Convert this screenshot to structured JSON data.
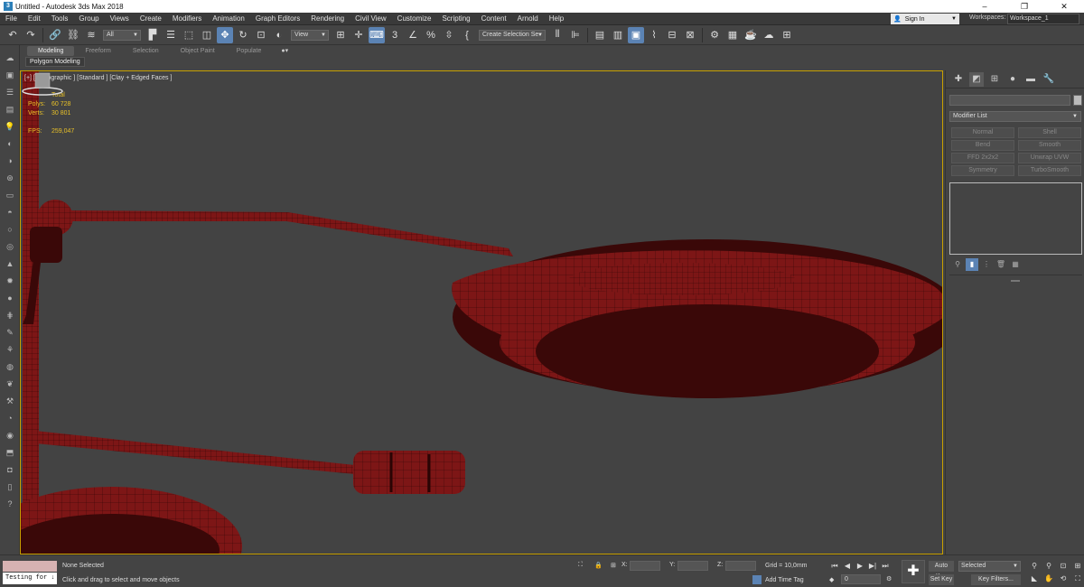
{
  "window": {
    "title": "Untitled - Autodesk 3ds Max 2018",
    "app_icon": "3",
    "controls": [
      "–",
      "❐",
      "✕"
    ]
  },
  "menu": {
    "items": [
      "File",
      "Edit",
      "Tools",
      "Group",
      "Views",
      "Create",
      "Modifiers",
      "Animation",
      "Graph Editors",
      "Rendering",
      "Civil View",
      "Customize",
      "Scripting",
      "Content",
      "Arnold",
      "Help"
    ],
    "sign_in": "Sign In",
    "workspaces_label": "Workspaces:",
    "workspace_value": "Workspace_1"
  },
  "toolbar": {
    "selection_filter": "All",
    "ref_coord": "View",
    "named_selection": "Create Selection Se"
  },
  "ribbon": {
    "tabs": [
      "Modeling",
      "Freeform",
      "Selection",
      "Object Paint",
      "Populate"
    ],
    "active_tab": "Modeling",
    "dots": "●▾",
    "polygon_modeling": "Polygon Modeling"
  },
  "viewport": {
    "label": "[+] [Orthographic ] [Standard ] [Clay + Edged Faces ]",
    "stats": {
      "total_label": "Total",
      "polys_label": "Polys:",
      "polys_value": "60 728",
      "verts_label": "Verts:",
      "verts_value": "30 801",
      "fps_label": "FPS:",
      "fps_value": "259,047"
    },
    "mesh_color": "#7d1616",
    "mesh_shadow": "#3a0808",
    "wire_color": "#2a0404",
    "border_color": "#c8a000"
  },
  "command_panel": {
    "modifier_list": "Modifier List",
    "modifier_buttons": [
      "Normal",
      "Shell",
      "Bend",
      "Smooth",
      "FFD 2x2x2",
      "Unwrap UVW",
      "Symmetry",
      "TurboSmooth"
    ]
  },
  "status": {
    "maxscript_text": "Testing for ↓",
    "selection": "None Selected",
    "prompt": "Click and drag to select and move objects",
    "x_label": "X:",
    "y_label": "Y:",
    "z_label": "Z:",
    "grid": "Grid = 10,0mm",
    "add_time_tag": "Add Time Tag",
    "frame": "0",
    "auto_key": "Auto Key",
    "set_key": "Set Key",
    "selected_value": "Selected",
    "key_filters": "Key Filters..."
  }
}
